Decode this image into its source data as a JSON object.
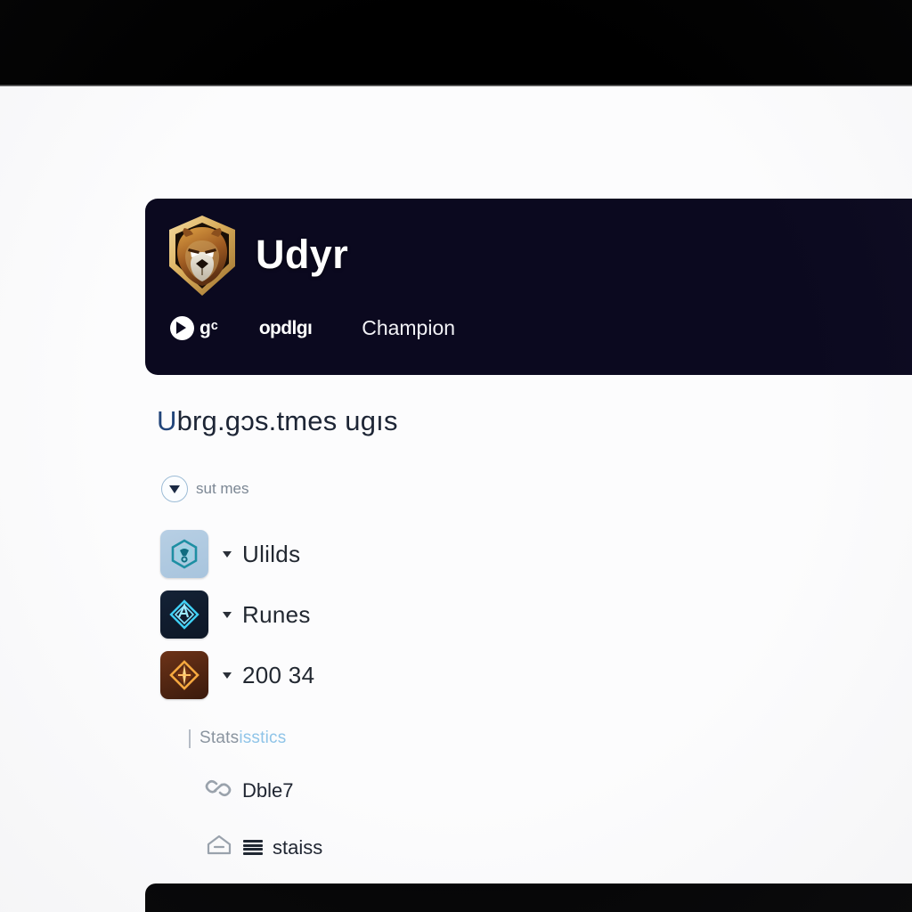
{
  "window": {
    "top_bar_color": "#000000",
    "page_background": "#fcfcfd"
  },
  "banner": {
    "background_color": "#0b091f",
    "emblem_icon": "lion-shield-emblem",
    "champion_name": "Udyr",
    "meta": {
      "gg_icon": "gg-circle-icon",
      "gg_label": "gᶜ",
      "opgg_label": "opdlgı",
      "champion_label": "Champion"
    }
  },
  "heading": {
    "lead": "U",
    "rest": "brg.gɔs.tmes ugıs"
  },
  "subnote": {
    "icon": "chevron-down-circle-icon",
    "label": "sut mes"
  },
  "nav": {
    "items": [
      {
        "icon": "builds-shield-icon",
        "tile_color": "#b0c9e0",
        "caret": "chevron-down-icon",
        "label": "Ulilds"
      },
      {
        "icon": "runes-diamond-icon",
        "tile_color": "#0f1c2e",
        "caret": "chevron-down-icon",
        "label": "Runes"
      },
      {
        "icon": "items-diamond-icon",
        "tile_color": "#53240f",
        "caret": "chevron-down-icon",
        "label": "200 34"
      }
    ]
  },
  "statistics": {
    "title_plain": "Stats",
    "title_accent": "isstics",
    "accent_color": "#8fc4e8",
    "rows": [
      {
        "icon": "chain-link-icon",
        "label": "Dble7"
      },
      {
        "icon": "envelope-outline-icon",
        "secondary_icon": "hamburger-icon",
        "label": "staiss"
      }
    ]
  },
  "bottom_panel": {
    "background_color": "#050506"
  }
}
